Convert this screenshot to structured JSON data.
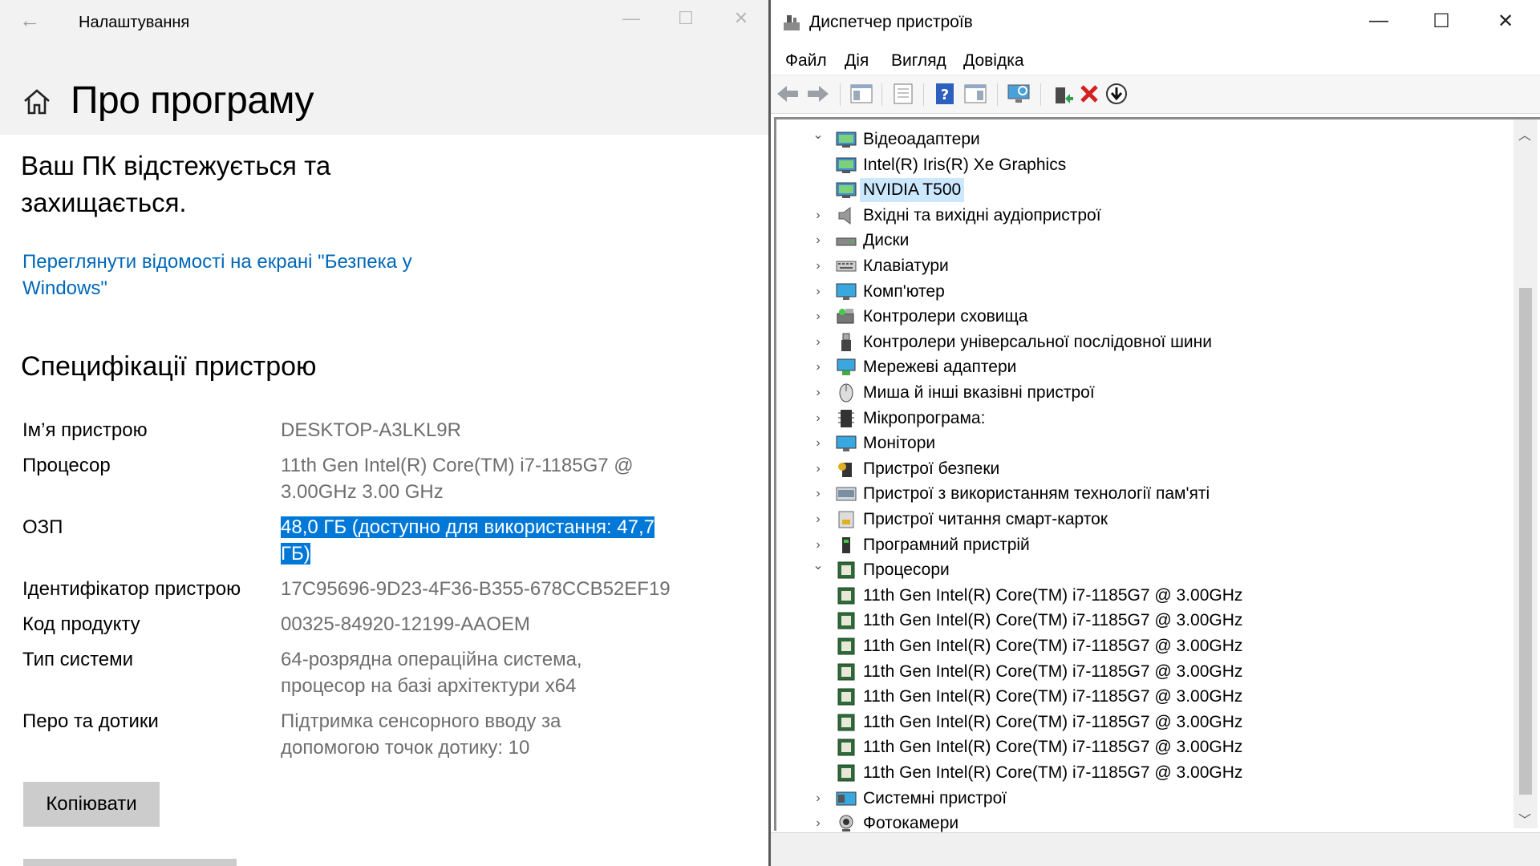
{
  "settings": {
    "window_title": "Налаштування",
    "page_title": "Про програму",
    "protection_text": "Ваш ПК відстежується та захищається.",
    "security_link": "Переглянути відомості на екрані \"Безпека у Windows\"",
    "specs_title": "Специфікації пристрою",
    "specs": [
      {
        "label": "Ім’я пристрою",
        "value": "DESKTOP-A3LKL9R"
      },
      {
        "label": "Процесор",
        "value": "11th Gen Intel(R) Core(TM) i7-1185G7 @ 3.00GHz   3.00 GHz"
      },
      {
        "label": "ОЗП",
        "value": "48,0 ГБ (доступно для використання: 47,7 ГБ)"
      },
      {
        "label": "Ідентифікатор пристрою",
        "value": "17C95696-9D23-4F36-B355-678CCB52EF19"
      },
      {
        "label": "Код продукту",
        "value": "00325-84920-12199-AAOEM"
      },
      {
        "label": "Тип системи",
        "value": "64-розрядна операційна система, процесор на базі архітектури x64"
      },
      {
        "label": "Перо та дотики",
        "value": "Підтримка сенсорного вводу за допомогою точок дотику: 10"
      }
    ],
    "copy_button": "Копіювати"
  },
  "devmgr": {
    "window_title": "Диспетчер пристроїв",
    "menu": [
      "Файл",
      "Дія",
      "Вигляд",
      "Довідка"
    ],
    "tree": [
      {
        "label": "Відеоадаптери",
        "expanded": true,
        "icon": "display-adapter-icon"
      },
      {
        "label": "Intel(R) Iris(R) Xe Graphics",
        "child": true,
        "icon": "display-adapter-icon"
      },
      {
        "label": "NVIDIA T500",
        "child": true,
        "selected": true,
        "icon": "display-adapter-icon"
      },
      {
        "label": "Вхідні та вихідні аудіопристрої",
        "icon": "speaker-icon"
      },
      {
        "label": "Диски",
        "icon": "disk-drive-icon"
      },
      {
        "label": "Клавіатури",
        "icon": "keyboard-icon"
      },
      {
        "label": "Комп'ютер",
        "icon": "computer-icon"
      },
      {
        "label": "Контролери сховища",
        "icon": "storage-controller-icon"
      },
      {
        "label": "Контролери універсальної послідовної шини",
        "icon": "usb-icon"
      },
      {
        "label": "Мережеві адаптери",
        "icon": "network-adapter-icon"
      },
      {
        "label": "Миша й інші вказівні пристрої",
        "icon": "mouse-icon"
      },
      {
        "label": "Мікропрограма:",
        "icon": "firmware-icon"
      },
      {
        "label": "Монітори",
        "icon": "monitor-icon"
      },
      {
        "label": "Пристрої безпеки",
        "icon": "security-device-icon"
      },
      {
        "label": "Пристрої з використанням технології пам'яті",
        "icon": "memory-device-icon"
      },
      {
        "label": "Пристрої читання смарт-карток",
        "icon": "smart-card-reader-icon"
      },
      {
        "label": "Програмний пристрій",
        "icon": "software-device-icon"
      },
      {
        "label": "Процесори",
        "expanded": true,
        "icon": "processor-icon"
      },
      {
        "label": "11th Gen Intel(R) Core(TM) i7-1185G7 @ 3.00GHz",
        "child": true,
        "icon": "processor-icon"
      },
      {
        "label": "11th Gen Intel(R) Core(TM) i7-1185G7 @ 3.00GHz",
        "child": true,
        "icon": "processor-icon"
      },
      {
        "label": "11th Gen Intel(R) Core(TM) i7-1185G7 @ 3.00GHz",
        "child": true,
        "icon": "processor-icon"
      },
      {
        "label": "11th Gen Intel(R) Core(TM) i7-1185G7 @ 3.00GHz",
        "child": true,
        "icon": "processor-icon"
      },
      {
        "label": "11th Gen Intel(R) Core(TM) i7-1185G7 @ 3.00GHz",
        "child": true,
        "icon": "processor-icon"
      },
      {
        "label": "11th Gen Intel(R) Core(TM) i7-1185G7 @ 3.00GHz",
        "child": true,
        "icon": "processor-icon"
      },
      {
        "label": "11th Gen Intel(R) Core(TM) i7-1185G7 @ 3.00GHz",
        "child": true,
        "icon": "processor-icon"
      },
      {
        "label": "11th Gen Intel(R) Core(TM) i7-1185G7 @ 3.00GHz",
        "child": true,
        "icon": "processor-icon"
      },
      {
        "label": "Системні пристрої",
        "icon": "system-device-icon"
      },
      {
        "label": "Фотокамери",
        "icon": "camera-icon"
      }
    ]
  },
  "colors": {
    "link": "#0067b8",
    "highlight": "#0078d7",
    "selection": "#cce8ff"
  }
}
